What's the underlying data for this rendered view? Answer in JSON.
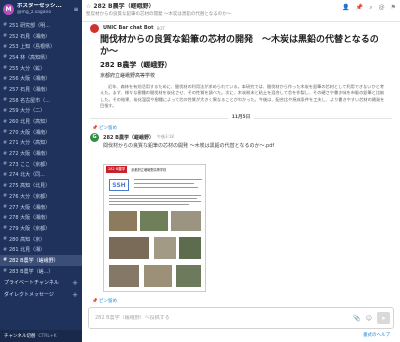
{
  "team": {
    "initial": "M",
    "name": "ポスターセッシ...",
    "user": "@mg_z.sagano"
  },
  "channels": [
    "251 研究部（明...",
    "252 石見（湘南）",
    "253 上知（島根県）",
    "254 林（高知県）",
    "255 大分（鉱）",
    "256 大阪（湘南）",
    "257 石見（湘南）",
    "258 名古屋市（...",
    "259 大分（二）",
    "260 北見（高知）",
    "270 大阪（湘南）",
    "271 大分（高知）",
    "272 大阪（湘南）",
    "273 ここ（京都）",
    "274 北大（同...",
    "275 高知（北見）",
    "276 大分（京都）",
    "277 大阪（湘南）",
    "278 大阪（湘南）",
    "279 大阪（京都）",
    "280 高知（京）",
    "281 北見（湘）",
    "282 B農学（嵯峨野）",
    "283 B農学（嵯...）"
  ],
  "active_channel_index": 22,
  "sidebar": {
    "private_label": "プライベートチャンネル",
    "dm_label": "ダイレクトメッセージ",
    "switcher_label": "チャンネル切替",
    "switcher_key": "CTRL+K"
  },
  "header": {
    "star": "☆",
    "title": "282 B農学（嵯峨野）",
    "purpose": "堅炭材からの良質な鉛筆の芯材の開発 〜木炭は黒鉛の代替となるのか〜"
  },
  "post1": {
    "username": "UNIC Bar chat Bot",
    "badge": "BOT",
    "paper_title": "間伐材からの良質な鉛筆の芯材の開発　〜木炭は黒鉛の代替となるのか〜",
    "paper_subtitle": "282 B農学（嵯峨野）",
    "paper_school": "京都府立嵯峨野高等学校",
    "paper_body": "近年、森林を有効活用するために、間伐材の利用法が求められている。本研究では、間伐材から作った木炭を鉛筆の芯材として利用できないかと考えた。まず、様々な樹種の間伐材を炭化させ、その性質を調べた。次に、木炭粉末と粘土を混合して芯を作製し、その硬さや書き味を市販の鉛筆と比較した。その結果、炭化温度や樹種によって芯の性質が大きく異なることがわかった。今後は、配合比や焼成条件を工夫し、より書きやすい芯材の開発を目指す。"
  },
  "date_separator": "11月5日",
  "pinned1": "ピン留め",
  "post2": {
    "avatar_initial": "G",
    "username": "282 B農学（嵯峨野）",
    "time": "午後3:18",
    "text": "間伐材からの良質な鉛筆の芯材の開発 〜木炭は黒鉛の代替となるのか〜.pdf"
  },
  "preview": {
    "tag": "282 B農学",
    "school": "京都府立嵯峨野高等学校",
    "logo": "SSH"
  },
  "pinned2": "ピン留め",
  "composer": {
    "placeholder": "282 B農学（嵯峨野）へ投稿する"
  },
  "help_link": "書式のヘルプ",
  "colors": {
    "sidebar_bg": "#1e325c",
    "active_bg": "#3b4e78",
    "link": "#2389d7",
    "accent_red": "#c8212c"
  }
}
